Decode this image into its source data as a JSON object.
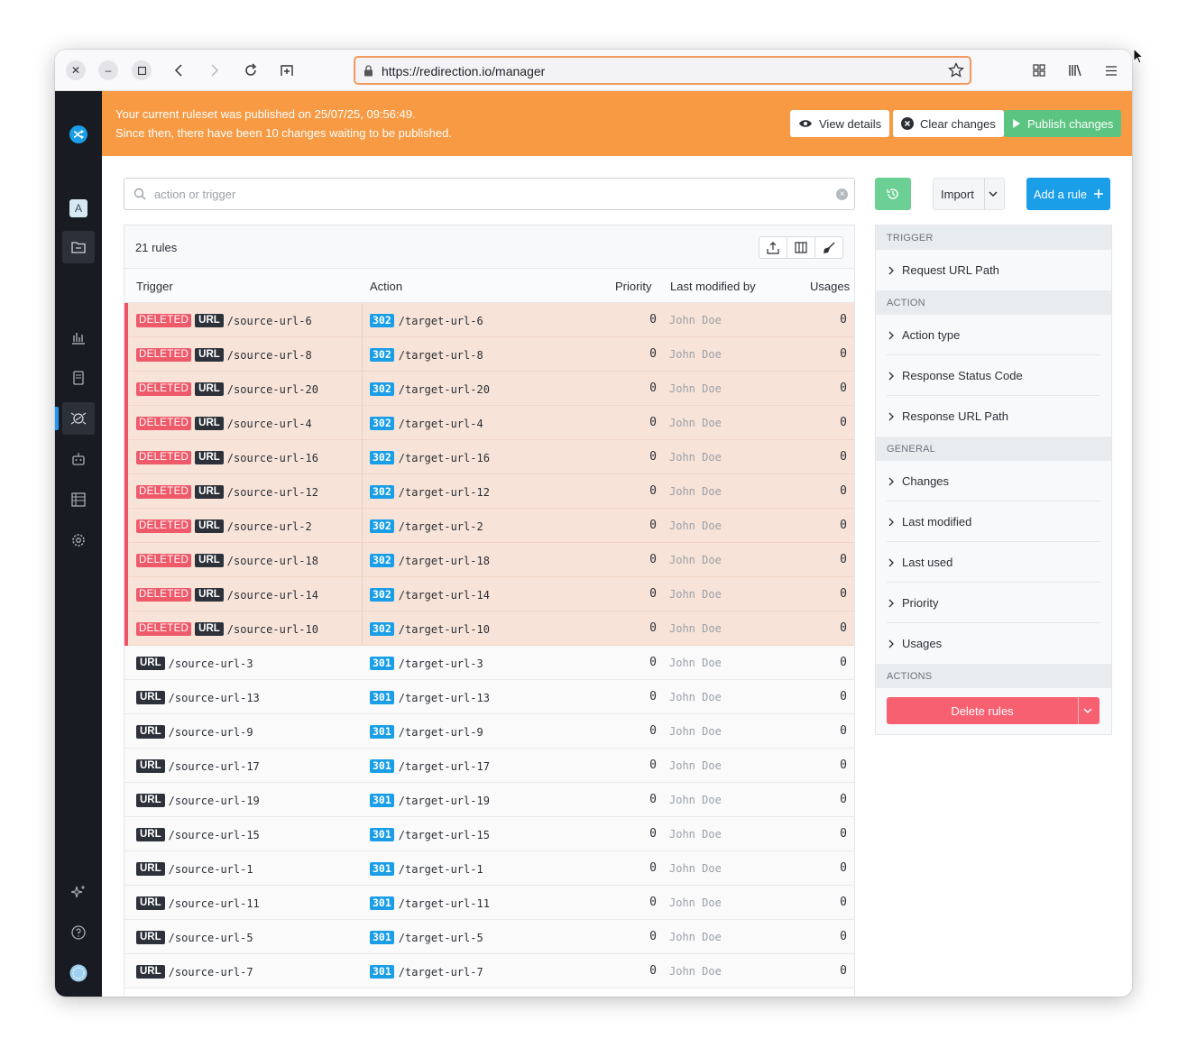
{
  "browser": {
    "url": "https://redirection.io/manager"
  },
  "banner": {
    "line1": "Your current ruleset was published on 25/07/25, 09:56:49.",
    "line2": "Since then, there have been 10 changes waiting to be published.",
    "view_details": "View details",
    "clear_changes": "Clear changes",
    "publish_changes": "Publish changes",
    "color": "#f79a43"
  },
  "sidebar": {
    "project_initial": "A",
    "accent": "#2196f3"
  },
  "search": {
    "placeholder": "action or trigger"
  },
  "toolbar": {
    "import_label": "Import",
    "add_rule_label": "Add a rule"
  },
  "table": {
    "count_label": "21 rules",
    "columns": {
      "trigger": "Trigger",
      "action": "Action",
      "priority": "Priority",
      "modified_by": "Last modified by",
      "usages": "Usages"
    },
    "deleted_badge": "DELETED",
    "url_badge": "URL",
    "rows": [
      {
        "deleted": true,
        "source": "/source-url-6",
        "code": "302",
        "target": "/target-url-6",
        "priority": "0",
        "by": "John Doe",
        "usages": "0"
      },
      {
        "deleted": true,
        "source": "/source-url-8",
        "code": "302",
        "target": "/target-url-8",
        "priority": "0",
        "by": "John Doe",
        "usages": "0"
      },
      {
        "deleted": true,
        "source": "/source-url-20",
        "code": "302",
        "target": "/target-url-20",
        "priority": "0",
        "by": "John Doe",
        "usages": "0"
      },
      {
        "deleted": true,
        "source": "/source-url-4",
        "code": "302",
        "target": "/target-url-4",
        "priority": "0",
        "by": "John Doe",
        "usages": "0"
      },
      {
        "deleted": true,
        "source": "/source-url-16",
        "code": "302",
        "target": "/target-url-16",
        "priority": "0",
        "by": "John Doe",
        "usages": "0"
      },
      {
        "deleted": true,
        "source": "/source-url-12",
        "code": "302",
        "target": "/target-url-12",
        "priority": "0",
        "by": "John Doe",
        "usages": "0"
      },
      {
        "deleted": true,
        "source": "/source-url-2",
        "code": "302",
        "target": "/target-url-2",
        "priority": "0",
        "by": "John Doe",
        "usages": "0"
      },
      {
        "deleted": true,
        "source": "/source-url-18",
        "code": "302",
        "target": "/target-url-18",
        "priority": "0",
        "by": "John Doe",
        "usages": "0"
      },
      {
        "deleted": true,
        "source": "/source-url-14",
        "code": "302",
        "target": "/target-url-14",
        "priority": "0",
        "by": "John Doe",
        "usages": "0"
      },
      {
        "deleted": true,
        "source": "/source-url-10",
        "code": "302",
        "target": "/target-url-10",
        "priority": "0",
        "by": "John Doe",
        "usages": "0"
      },
      {
        "deleted": false,
        "source": "/source-url-3",
        "code": "301",
        "target": "/target-url-3",
        "priority": "0",
        "by": "John Doe",
        "usages": "0"
      },
      {
        "deleted": false,
        "source": "/source-url-13",
        "code": "301",
        "target": "/target-url-13",
        "priority": "0",
        "by": "John Doe",
        "usages": "0"
      },
      {
        "deleted": false,
        "source": "/source-url-9",
        "code": "301",
        "target": "/target-url-9",
        "priority": "0",
        "by": "John Doe",
        "usages": "0"
      },
      {
        "deleted": false,
        "source": "/source-url-17",
        "code": "301",
        "target": "/target-url-17",
        "priority": "0",
        "by": "John Doe",
        "usages": "0"
      },
      {
        "deleted": false,
        "source": "/source-url-19",
        "code": "301",
        "target": "/target-url-19",
        "priority": "0",
        "by": "John Doe",
        "usages": "0"
      },
      {
        "deleted": false,
        "source": "/source-url-15",
        "code": "301",
        "target": "/target-url-15",
        "priority": "0",
        "by": "John Doe",
        "usages": "0"
      },
      {
        "deleted": false,
        "source": "/source-url-1",
        "code": "301",
        "target": "/target-url-1",
        "priority": "0",
        "by": "John Doe",
        "usages": "0"
      },
      {
        "deleted": false,
        "source": "/source-url-11",
        "code": "301",
        "target": "/target-url-11",
        "priority": "0",
        "by": "John Doe",
        "usages": "0"
      },
      {
        "deleted": false,
        "source": "/source-url-5",
        "code": "301",
        "target": "/target-url-5",
        "priority": "0",
        "by": "John Doe",
        "usages": "0"
      },
      {
        "deleted": false,
        "source": "/source-url-7",
        "code": "301",
        "target": "/target-url-7",
        "priority": "0",
        "by": "John Doe",
        "usages": "0"
      }
    ]
  },
  "filters": {
    "trigger_title": "TRIGGER",
    "trigger_items": [
      "Request URL Path"
    ],
    "action_title": "ACTION",
    "action_items": [
      "Action type",
      "Response Status Code",
      "Response URL Path"
    ],
    "general_title": "GENERAL",
    "general_items": [
      "Changes",
      "Last modified",
      "Last used",
      "Priority",
      "Usages"
    ],
    "actions_title": "ACTIONS",
    "delete_rules": "Delete rules"
  }
}
